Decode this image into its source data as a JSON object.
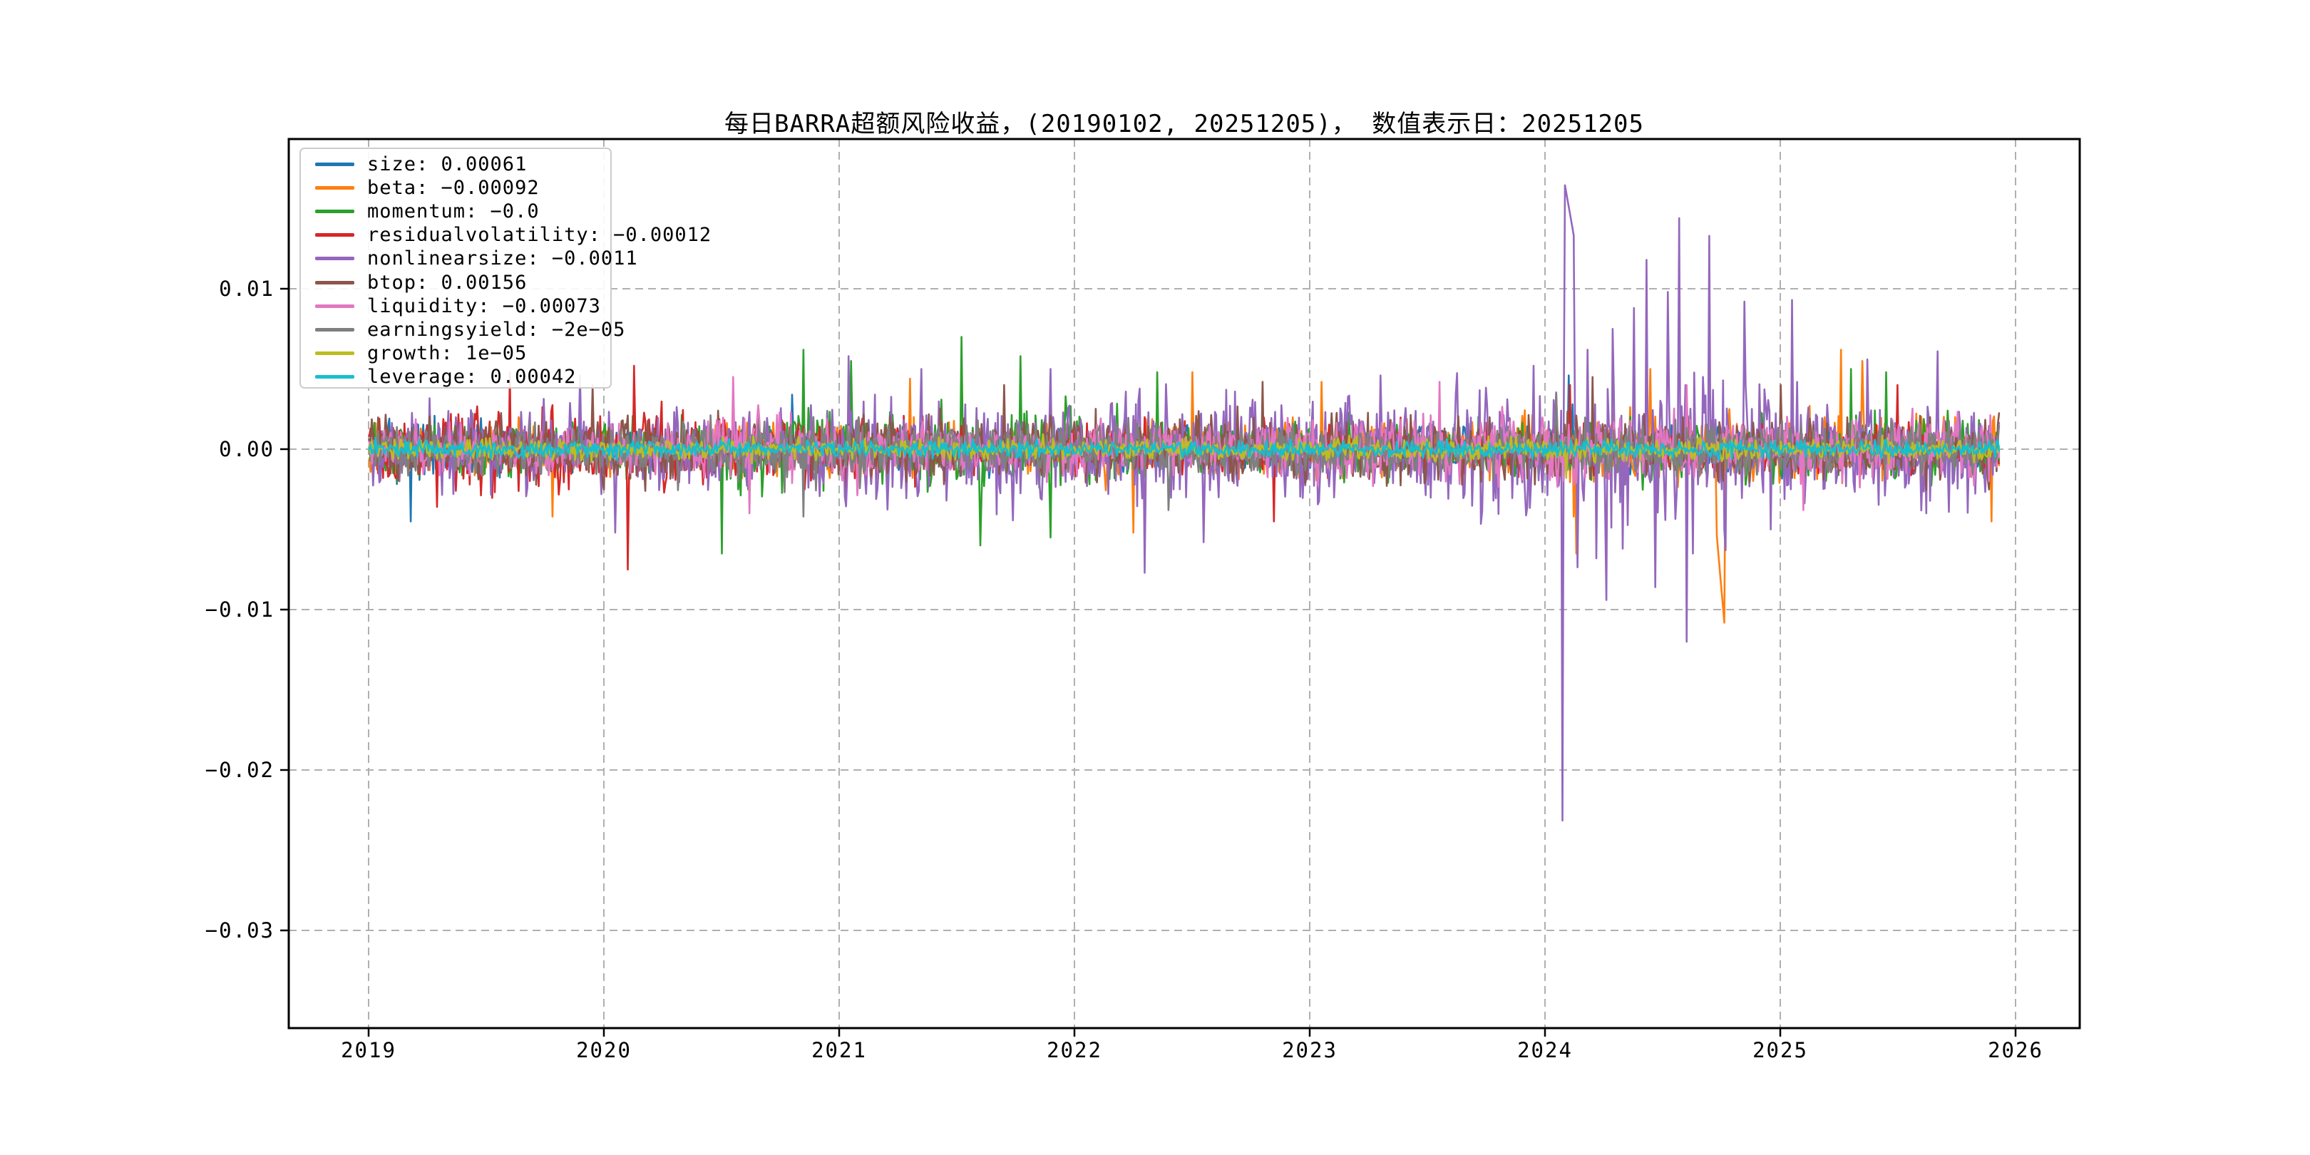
{
  "title": "每日BARRA超额风险收益，(20190102, 20251205)， 数值表示日：20251205",
  "axes": {
    "y_ticks": [
      "0.01",
      "0.00",
      "−0.01",
      "−0.02",
      "−0.03"
    ],
    "x_ticks": [
      "2019",
      "2020",
      "2021",
      "2022",
      "2023",
      "2024",
      "2025",
      "2026"
    ]
  },
  "chart_data": {
    "type": "line",
    "title": "每日BARRA超额风险收益，(20190102, 20251205)， 数值表示日：20251205",
    "date_range_start": "20190102",
    "date_range_end": "20251205",
    "value_display_date": "20251205",
    "xlabel": "",
    "ylabel": "",
    "x_tick_years": [
      2019,
      2020,
      2021,
      2022,
      2023,
      2024,
      2025,
      2026
    ],
    "y_tick_values": [
      0.01,
      0.0,
      -0.01,
      -0.02,
      -0.03
    ],
    "xlim": [
      2018.66,
      2026.27
    ],
    "ylim": [
      -0.0361,
      0.0193
    ],
    "grid": "dashed-gray-both-axes",
    "legend_position": "upper-left",
    "t_start": 2019.003,
    "t_end": 2025.93,
    "series": [
      {
        "name": "size",
        "value": 0.00061,
        "label": "size: 0.00061",
        "color": "#1f77b4",
        "amp": 0.0011,
        "env": [
          [
            2019,
            2019.6,
            1.2
          ]
        ],
        "spikes": [
          [
            2019.18,
            -0.0045
          ],
          [
            2020.8,
            0.0034
          ],
          [
            2024.1,
            0.0046
          ],
          [
            2024.115,
            0.0028
          ]
        ],
        "ramps": []
      },
      {
        "name": "beta",
        "value": -0.00092,
        "label": "beta: −0.00092",
        "color": "#ff7f0e",
        "amp": 0.0013,
        "env": [
          [
            2022,
            2023.2,
            1.2
          ],
          [
            2023.9,
            2025.95,
            1.3
          ]
        ],
        "spikes": [
          [
            2019.78,
            -0.0042
          ],
          [
            2021.3,
            0.0044
          ],
          [
            2022.25,
            -0.0052
          ],
          [
            2022.5,
            0.0048
          ],
          [
            2023.05,
            0.0042
          ],
          [
            2024.12,
            -0.0042
          ],
          [
            2024.135,
            -0.0065
          ],
          [
            2024.45,
            0.005
          ],
          [
            2025.26,
            0.0062
          ],
          [
            2025.35,
            0.0055
          ],
          [
            2025.9,
            -0.0045
          ]
        ],
        "ramps": [
          [
            2024.725,
            2024.765,
            -0.0045,
            -0.0113
          ]
        ]
      },
      {
        "name": "momentum",
        "value": -0.0,
        "label": "momentum: −0.0",
        "color": "#2ca02c",
        "amp": 0.0015,
        "env": [
          [
            2020.3,
            2022.3,
            1.35
          ],
          [
            2025.2,
            2025.95,
            1.15
          ]
        ],
        "spikes": [
          [
            2020.5,
            -0.0065
          ],
          [
            2020.85,
            0.0062
          ],
          [
            2021.05,
            0.0055
          ],
          [
            2021.52,
            0.007
          ],
          [
            2021.6,
            -0.006
          ],
          [
            2021.77,
            0.0058
          ],
          [
            2021.9,
            -0.0055
          ],
          [
            2022.35,
            0.0048
          ],
          [
            2025.3,
            0.005
          ],
          [
            2025.45,
            0.0048
          ]
        ],
        "ramps": []
      },
      {
        "name": "residualvolatility",
        "value": -0.00012,
        "label": "residualvolatility: −0.00012",
        "color": "#d62728",
        "amp": 0.0016,
        "env": [
          [
            2019,
            2020.5,
            1.25
          ],
          [
            2021.5,
            2026,
            0.75
          ]
        ],
        "spikes": [
          [
            2019.29,
            -0.0036
          ],
          [
            2019.6,
            0.0048
          ],
          [
            2020.1,
            -0.0075
          ],
          [
            2020.13,
            0.0052
          ],
          [
            2022.85,
            -0.0045
          ],
          [
            2024.105,
            0.004
          ],
          [
            2025.5,
            0.004
          ]
        ],
        "ramps": []
      },
      {
        "name": "nonlinearsize",
        "value": -0.0011,
        "label": "nonlinearsize: −0.0011",
        "color": "#9467bd",
        "amp": 0.0021,
        "env": [
          [
            2019,
            2021,
            0.95
          ],
          [
            2021,
            2023.6,
            1.25
          ],
          [
            2023.6,
            2024.95,
            1.6
          ],
          [
            2024.95,
            2026,
            1.3
          ]
        ],
        "spikes": [
          [
            2019.9,
            0.0046
          ],
          [
            2020.05,
            -0.0052
          ],
          [
            2021.04,
            0.0058
          ],
          [
            2021.35,
            0.005
          ],
          [
            2021.9,
            0.005
          ],
          [
            2022.3,
            -0.0077
          ],
          [
            2022.55,
            -0.0058
          ],
          [
            2023.3,
            0.0046
          ],
          [
            2023.95,
            0.0052
          ],
          [
            2024.18,
            0.0062
          ],
          [
            2024.22,
            -0.0068
          ],
          [
            2024.26,
            -0.0094
          ],
          [
            2024.29,
            0.0075
          ],
          [
            2024.33,
            -0.0062
          ],
          [
            2024.38,
            0.0088
          ],
          [
            2024.43,
            0.0118
          ],
          [
            2024.47,
            -0.0086
          ],
          [
            2024.52,
            0.0098
          ],
          [
            2024.57,
            0.0144
          ],
          [
            2024.6,
            -0.012
          ],
          [
            2024.63,
            -0.0065
          ],
          [
            2024.7,
            0.0133
          ],
          [
            2024.77,
            -0.0063
          ],
          [
            2024.85,
            0.0092
          ],
          [
            2024.96,
            -0.005
          ],
          [
            2025.05,
            0.0093
          ],
          [
            2025.37,
            0.0056
          ],
          [
            2025.62,
            -0.004
          ],
          [
            2025.67,
            0.0061
          ]
        ],
        "ramps": [
          [
            2024.071,
            2024.079,
            -0.016,
            -0.0335
          ],
          [
            2024.082,
            2024.125,
            0.0167,
            0.0131
          ],
          [
            2024.128,
            2024.14,
            0.0082,
            -0.01
          ]
        ]
      },
      {
        "name": "btop",
        "value": 0.00156,
        "label": "btop: 0.00156",
        "color": "#8c564b",
        "amp": 0.0016,
        "env": [],
        "spikes": [
          [
            2019.95,
            0.004
          ],
          [
            2021.7,
            0.004
          ],
          [
            2022.8,
            0.0042
          ],
          [
            2024.2,
            0.0045
          ],
          [
            2025.0,
            0.004
          ]
        ],
        "ramps": []
      },
      {
        "name": "liquidity",
        "value": -0.00073,
        "label": "liquidity: −0.00073",
        "color": "#e377c2",
        "amp": 0.0012,
        "env": [
          [
            2020.4,
            2021.1,
            1.5
          ],
          [
            2023,
            2026,
            1.35
          ]
        ],
        "spikes": [
          [
            2020.55,
            0.0045
          ],
          [
            2020.62,
            -0.004
          ],
          [
            2023.55,
            0.0042
          ],
          [
            2024.6,
            0.004
          ],
          [
            2025.1,
            -0.0038
          ]
        ],
        "ramps": []
      },
      {
        "name": "earningsyield",
        "value": -2e-05,
        "label": "earningsyield: −2e−05",
        "color": "#7f7f7f",
        "amp": 0.0012,
        "env": [
          [
            2020.3,
            2021.2,
            1.3
          ]
        ],
        "spikes": [
          [
            2020.85,
            -0.0042
          ],
          [
            2022.4,
            -0.0038
          ],
          [
            2024.05,
            0.0035
          ]
        ],
        "ramps": []
      },
      {
        "name": "growth",
        "value": 1e-05,
        "label": "growth: 1e−05",
        "color": "#bcbd22",
        "amp": 0.00055,
        "env": [],
        "spikes": [
          [
            2024.09,
            -0.0018
          ]
        ],
        "ramps": []
      },
      {
        "name": "leverage",
        "value": 0.00042,
        "label": "leverage: 0.00042",
        "color": "#17becf",
        "amp": 0.00042,
        "env": [],
        "spikes": [],
        "ramps": []
      }
    ]
  }
}
